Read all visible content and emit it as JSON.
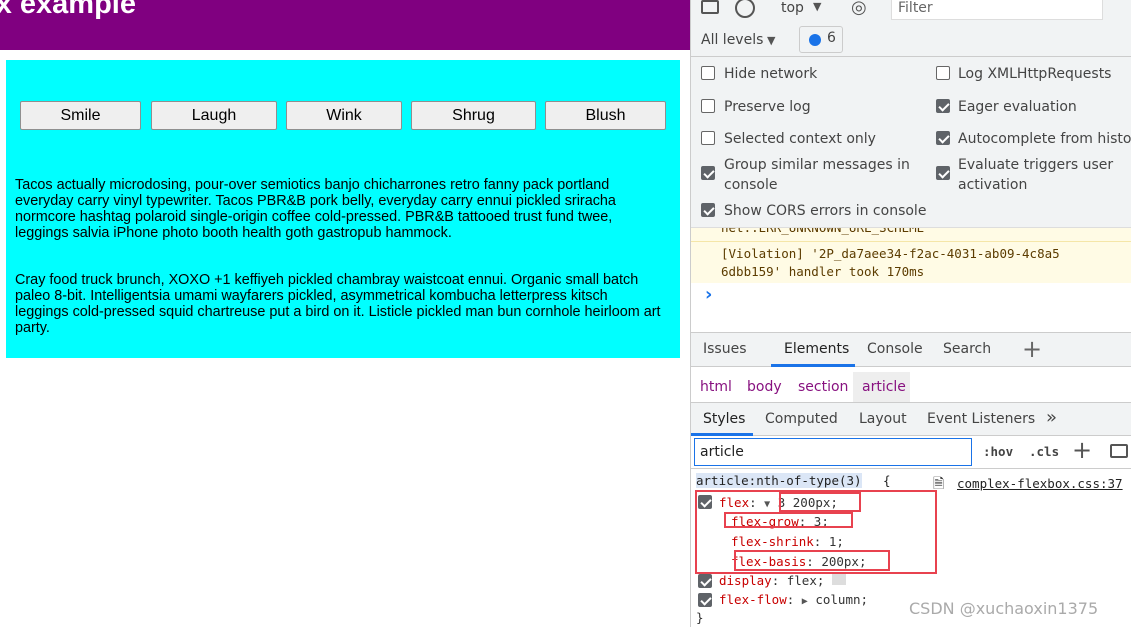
{
  "page": {
    "title": "ox example",
    "buttons": [
      "Smile",
      "Laugh",
      "Wink",
      "Shrug",
      "Blush"
    ],
    "paragraphs": [
      "Tacos actually microdosing, pour-over semiotics banjo chicharrones retro fanny pack portland everyday carry vinyl typewriter. Tacos PBR&B pork belly, everyday carry ennui pickled sriracha normcore hashtag polaroid single-origin coffee cold-pressed. PBR&B tattooed trust fund twee, leggings salvia iPhone photo booth health goth gastropub hammock.",
      "Cray food truck brunch, XOXO +1 keffiyeh pickled chambray waistcoat ennui. Organic small batch paleo 8-bit. Intelligentsia umami wayfarers pickled, asymmetrical kombucha letterpress kitsch leggings cold-pressed squid chartreuse put a bird on it. Listicle pickled man bun cornhole heirloom art party."
    ],
    "colors": {
      "header": "#800080",
      "box": "#00ffff"
    }
  },
  "console": {
    "context": "top",
    "filter_placeholder": "Filter",
    "levels": "All levels",
    "message_count": "6",
    "options_left": [
      {
        "label": "Hide network",
        "checked": false
      },
      {
        "label": "Preserve log",
        "checked": false
      },
      {
        "label": "Selected context only",
        "checked": false
      },
      {
        "label": "Group similar messages in console",
        "checked": true
      },
      {
        "label": "Show CORS errors in console",
        "checked": true
      }
    ],
    "options_right": [
      {
        "label": "Log XMLHttpRequests",
        "checked": false
      },
      {
        "label": "Eager evaluation",
        "checked": true
      },
      {
        "label": "Autocomplete from history",
        "checked": true
      },
      {
        "label": "Evaluate triggers user activation",
        "checked": true
      }
    ],
    "messages": [
      "net::ERR_UNKNOWN_URL_SCHEME",
      "[Violation] '2P_da7aee34-f2ac-4031-ab09-4c8a56dbb159' handler took 170ms"
    ],
    "prompt": "›"
  },
  "drawer_tabs": [
    "Issues",
    "Elements",
    "Console",
    "Search"
  ],
  "breadcrumb": [
    "html",
    "body",
    "section",
    "article"
  ],
  "styles_tabs": [
    "Styles",
    "Computed",
    "Layout",
    "Event Listeners"
  ],
  "styles": {
    "filter": "article",
    "hov": ":hov",
    "cls": ".cls",
    "selector": "article:nth-of-type(3)",
    "source": "complex-flexbox.css:37",
    "decls": [
      {
        "p": "flex",
        "v": "3 200px;"
      },
      {
        "p": "flex-grow",
        "v": "3;"
      },
      {
        "p": "flex-shrink",
        "v": "1;"
      },
      {
        "p": "flex-basis",
        "v": "200px;"
      },
      {
        "p": "display",
        "v": "flex;"
      },
      {
        "p": "flex-flow",
        "v": "column;"
      }
    ]
  },
  "watermark": "CSDN @xuchaoxin1375"
}
